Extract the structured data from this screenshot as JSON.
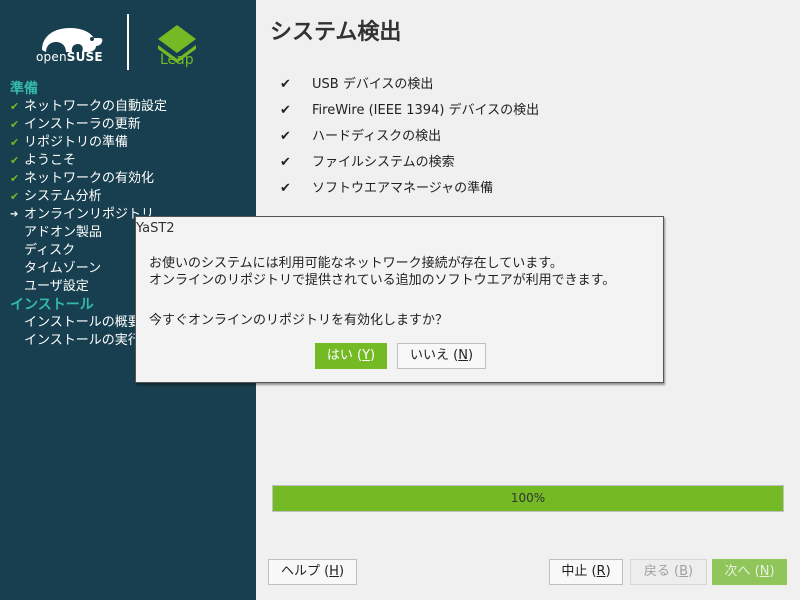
{
  "branding": {
    "distro_name_light": "open",
    "distro_name_bold": "SUSE",
    "edition": "Leap",
    "brand_green": "#73ba25",
    "sidebar_bg": "#173f4f",
    "section_color": "#35b9ab"
  },
  "sidebar": {
    "sections": [
      {
        "label": "準備",
        "steps": [
          {
            "label": "ネットワークの自動設定",
            "state": "done"
          },
          {
            "label": "インストーラの更新",
            "state": "done"
          },
          {
            "label": "リポジトリの準備",
            "state": "done"
          },
          {
            "label": "ようこそ",
            "state": "done"
          },
          {
            "label": "ネットワークの有効化",
            "state": "done"
          },
          {
            "label": "システム分析",
            "state": "done"
          },
          {
            "label": "オンラインリポジトリ",
            "state": "current"
          },
          {
            "label": "アドオン製品",
            "state": "pending"
          },
          {
            "label": "ディスク",
            "state": "pending"
          },
          {
            "label": "タイムゾーン",
            "state": "pending"
          },
          {
            "label": "ユーザ設定",
            "state": "pending"
          }
        ]
      },
      {
        "label": "インストール",
        "steps": [
          {
            "label": "インストールの概要",
            "state": "pending"
          },
          {
            "label": "インストールの実行",
            "state": "pending"
          }
        ]
      }
    ],
    "done_mark": "✔",
    "current_mark": "➔"
  },
  "main": {
    "title": "システム検出",
    "checks": [
      {
        "mark": "✔",
        "label": "USB デバイスの検出"
      },
      {
        "mark": "✔",
        "label": "FireWire (IEEE 1394) デバイスの検出"
      },
      {
        "mark": "✔",
        "label": "ハードディスクの検出"
      },
      {
        "mark": "✔",
        "label": "ファイルシステムの検索"
      },
      {
        "mark": "✔",
        "label": "ソフトウエアマネージャの準備"
      }
    ],
    "progress": {
      "value_percent": 100,
      "label": "100%"
    }
  },
  "footer": {
    "help": {
      "text": "ヘルプ (",
      "key": "H",
      "end": ")"
    },
    "abort": {
      "text": "中止 (",
      "key": "R",
      "end": ")"
    },
    "back": {
      "text": "戻る (",
      "key": "B",
      "end": ")"
    },
    "next": {
      "text": "次へ (",
      "key": "N",
      "end": ")"
    }
  },
  "dialog": {
    "title": "YaST2",
    "line1": "お使いのシステムには利用可能なネットワーク接続が存在しています。",
    "line2": "オンラインのリポジトリで提供されている追加のソフトウエアが利用できます。",
    "question": "今すぐオンラインのリポジトリを有効化しますか？",
    "yes": {
      "text": "はい (",
      "key": "Y",
      "end": ")"
    },
    "no": {
      "text": "いいえ (",
      "key": "N",
      "end": ")"
    }
  }
}
